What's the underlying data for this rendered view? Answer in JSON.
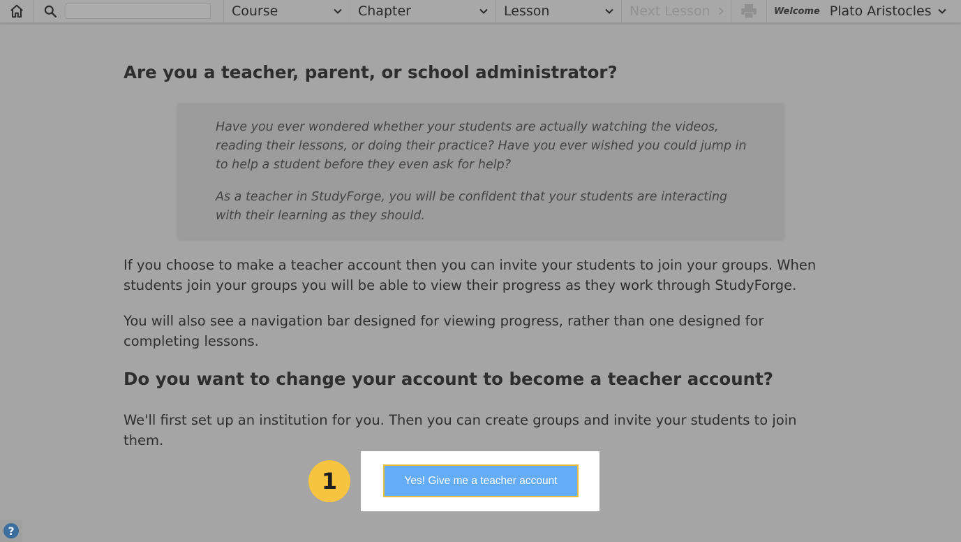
{
  "topbar": {
    "search_placeholder": "",
    "course_label": "Course",
    "chapter_label": "Chapter",
    "lesson_label": "Lesson",
    "next_lesson_label": "Next Lesson",
    "welcome_label": "Welcome",
    "user_name": "Plato Aristocles",
    "icons": [
      "home-icon",
      "search-icon",
      "chevron-down-icon",
      "chevron-right-icon",
      "print-icon"
    ]
  },
  "main": {
    "heading_teacher": "Are you a teacher, parent, or school administrator?",
    "quote_p1": "Have you ever wondered whether your students are actually watching the videos, reading their lessons, or doing their practice? Have you ever wished you could jump in to help a student before they even ask for help?",
    "quote_p2": "As a teacher in StudyForge, you will be confident that your students are interacting with their learning as they should.",
    "para_invite": "If you choose to make a teacher account then you can invite your students to join your groups. When students join your groups you will be able to view their progress as they work through StudyForge.",
    "para_navbar": "You will also see a navigation bar designed for viewing progress, rather than one designed for completing lessons.",
    "heading_change": "Do you want to change your account to become a teacher account?",
    "para_institution": "We'll first set up an institution for you. Then you can create groups and invite your students to join them.",
    "cta_label": "Yes! Give me a teacher account",
    "step_number": "1"
  },
  "help": {
    "label": "?"
  },
  "colors": {
    "overlay_background": "#a5a5a5",
    "cta_button": "#64acf6",
    "cta_border": "#e8be3f",
    "step_badge": "#f7c43f",
    "help_icon": "#3d6f9e"
  }
}
